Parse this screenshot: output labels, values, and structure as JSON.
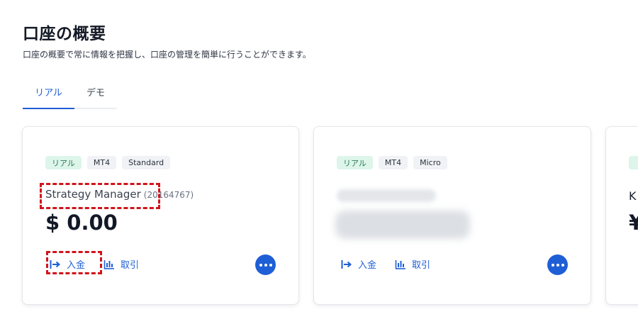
{
  "header": {
    "title": "口座の概要",
    "subtitle": "口座の概要で常に情報を把握し、口座の管理を簡単に行うことができます。"
  },
  "tabs": [
    {
      "label": "リアル",
      "active": true
    },
    {
      "label": "デモ",
      "active": false
    }
  ],
  "accounts": [
    {
      "tags": [
        "リアル",
        "MT4",
        "Standard"
      ],
      "name": "Strategy Manager",
      "number": "(20164767)",
      "balance": "$ 0.00",
      "actions": {
        "deposit": "入金",
        "trade": "取引"
      }
    },
    {
      "tags": [
        "リアル",
        "MT4",
        "Micro"
      ],
      "name": "",
      "number": "",
      "balance": "",
      "actions": {
        "deposit": "入金",
        "trade": "取引"
      }
    },
    {
      "partial_name": "K",
      "partial_balance": "¥"
    }
  ],
  "colors": {
    "accent": "#1f5fd6",
    "tag_real_bg": "#ddf5ea",
    "tag_bg": "#f0f2f5",
    "highlight": "#d0141b"
  },
  "icons": [
    "deposit-arrow-icon",
    "chart-icon",
    "more-dots-icon"
  ]
}
